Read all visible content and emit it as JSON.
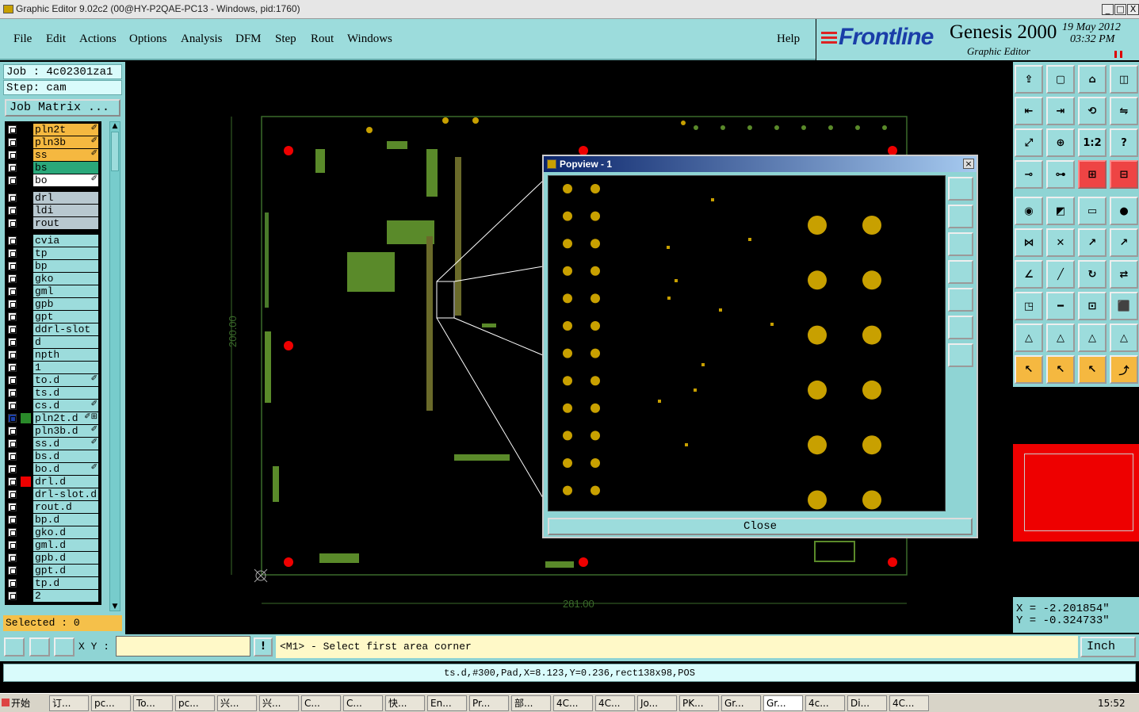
{
  "window": {
    "title": "Graphic Editor 9.02c2 (00@HY-P2QAE-PC13 - Windows, pid:1760)",
    "buttons": [
      "_",
      "□",
      "X"
    ]
  },
  "menu": [
    "File",
    "Edit",
    "Actions",
    "Options",
    "Analysis",
    "DFM",
    "Step",
    "Rout",
    "Windows"
  ],
  "help_label": "Help",
  "brand": {
    "logo": "Frontline",
    "product": "Genesis 2000",
    "subtitle": "Graphic Editor",
    "date": "19 May 2012",
    "time": "03:32 PM"
  },
  "job": {
    "job_label": "Job : 4c02301za1",
    "step_label": "Step: cam",
    "matrix_button": "Job Matrix ..."
  },
  "layers": [
    {
      "name": "pln2t",
      "color": "#f5b840",
      "mark": "✐"
    },
    {
      "name": "pln3b",
      "color": "#f5b840",
      "mark": "✐"
    },
    {
      "name": "ss",
      "color": "#f5b840",
      "mark": "✐"
    },
    {
      "name": "bs",
      "color": "#2aa87a",
      "mark": ""
    },
    {
      "name": "bo",
      "color": "#ffffff",
      "mark": "✐"
    },
    {
      "name": "drl",
      "color": "#b8c8d0",
      "mark": ""
    },
    {
      "name": "ldi",
      "color": "#b8c8d0",
      "mark": ""
    },
    {
      "name": "rout",
      "color": "#b8c8d0",
      "mark": ""
    },
    {
      "name": "cvia",
      "color": "#9cdcdc",
      "mark": ""
    },
    {
      "name": "tp",
      "color": "#9cdcdc",
      "mark": ""
    },
    {
      "name": "bp",
      "color": "#9cdcdc",
      "mark": ""
    },
    {
      "name": "gko",
      "color": "#9cdcdc",
      "mark": ""
    },
    {
      "name": "gml",
      "color": "#9cdcdc",
      "mark": ""
    },
    {
      "name": "gpb",
      "color": "#9cdcdc",
      "mark": ""
    },
    {
      "name": "gpt",
      "color": "#9cdcdc",
      "mark": ""
    },
    {
      "name": "ddrl-slot",
      "color": "#9cdcdc",
      "mark": ""
    },
    {
      "name": "d",
      "color": "#9cdcdc",
      "mark": ""
    },
    {
      "name": "npth",
      "color": "#9cdcdc",
      "mark": ""
    },
    {
      "name": "1",
      "color": "#9cdcdc",
      "mark": ""
    },
    {
      "name": "to.d",
      "color": "#9cdcdc",
      "mark": "✐"
    },
    {
      "name": "ts.d",
      "color": "#9cdcdc",
      "mark": ""
    },
    {
      "name": "cs.d",
      "color": "#9cdcdc",
      "mark": "✐"
    },
    {
      "name": "pln2t.d",
      "color": "#9cdcdc",
      "mark": "✐⊞"
    },
    {
      "name": "pln3b.d",
      "color": "#9cdcdc",
      "mark": "✐"
    },
    {
      "name": "ss.d",
      "color": "#9cdcdc",
      "mark": "✐"
    },
    {
      "name": "bs.d",
      "color": "#9cdcdc",
      "mark": ""
    },
    {
      "name": "bo.d",
      "color": "#9cdcdc",
      "mark": "✐"
    },
    {
      "name": "drl.d",
      "color": "#9cdcdc",
      "mark": ""
    },
    {
      "name": "drl-slot.d",
      "color": "#9cdcdc",
      "mark": ""
    },
    {
      "name": "rout.d",
      "color": "#9cdcdc",
      "mark": ""
    },
    {
      "name": "bp.d",
      "color": "#9cdcdc",
      "mark": ""
    },
    {
      "name": "gko.d",
      "color": "#9cdcdc",
      "mark": ""
    },
    {
      "name": "gml.d",
      "color": "#9cdcdc",
      "mark": ""
    },
    {
      "name": "gpb.d",
      "color": "#9cdcdc",
      "mark": ""
    },
    {
      "name": "gpt.d",
      "color": "#9cdcdc",
      "mark": ""
    },
    {
      "name": "tp.d",
      "color": "#9cdcdc",
      "mark": ""
    },
    {
      "name": "2",
      "color": "#9cdcdc",
      "mark": ""
    }
  ],
  "selected_label": "Selected : 0",
  "canvas": {
    "dim_vertical": "200.00",
    "dim_horizontal": "281.00"
  },
  "popview": {
    "title": "Popview - 1",
    "close_label": "Close"
  },
  "coords": {
    "x": "X = -2.201854\"",
    "y": "Y = -0.324733\""
  },
  "command": {
    "xy_label": "X Y :",
    "prompt": "<M1> - Select first area corner",
    "units": "Inch"
  },
  "status": "ts.d,#300,Pad,X=8.123,Y=0.236,rect138x98,POS",
  "taskbar": {
    "start": "开始",
    "items": [
      "订...",
      "pc...",
      "To...",
      "pc...",
      "兴...",
      "兴...",
      "C...",
      "C...",
      "快...",
      "En...",
      "Pr...",
      "部...",
      "4C...",
      "4C...",
      "Jo...",
      "PK...",
      "Gr...",
      "Gr...",
      "4c...",
      "Di...",
      "4C..."
    ],
    "clock": "15:52"
  },
  "tool_icons": [
    "save-icon",
    "open-icon",
    "home-icon",
    "window-icon",
    "undo-icon",
    "redo-icon",
    "step-icon",
    "snap-icon",
    "zoom-fit-icon",
    "zoom-icon",
    "scale-icon",
    "help-icon",
    "measure-icon",
    "drill-icon",
    "graph-icon",
    "graph2-icon",
    "circle-icon",
    "color-icon",
    "ruler-icon",
    "dot-icon",
    "connect-icon",
    "cross-icon",
    "arrow-icon",
    "arrow2-icon",
    "angle-icon",
    "line-icon",
    "rotate-icon",
    "flip-icon",
    "box-icon",
    "minus-icon",
    "center-icon",
    "shapes-icon",
    "tri-icon",
    "tri2-icon",
    "tri3-icon",
    "tri4-icon",
    "pointer-icon",
    "select-icon",
    "select2-icon",
    "path-icon"
  ]
}
